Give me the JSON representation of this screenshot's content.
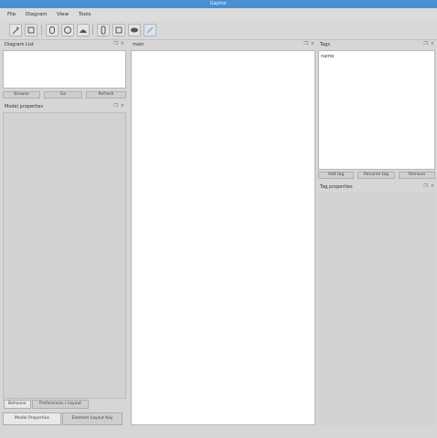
{
  "window": {
    "title": "Gaphor"
  },
  "menu": {
    "file": "File",
    "diagram": "Diagram",
    "view": "View",
    "tools": "Tools"
  },
  "toolbar": {
    "tools": [
      {
        "name": "pointer-tool-icon"
      },
      {
        "name": "comment-tool-icon"
      },
      {
        "name": "actor-tool-icon"
      },
      {
        "name": "use-case-tool-icon"
      },
      {
        "name": "package-tool-icon"
      },
      {
        "name": "class-tool-icon"
      },
      {
        "name": "component-tool-icon"
      },
      {
        "name": "node-tool-icon"
      },
      {
        "name": "line-tool-icon"
      }
    ]
  },
  "left_dock": {
    "top_title": "Diagram List",
    "buttons": [
      "Browse",
      "Go",
      "Refresh"
    ],
    "props_title": "Model properties",
    "tabs": [
      "Behavior",
      "Preferences / Layout"
    ],
    "bottom_tabs": [
      "Model Properties",
      "Element Layout Key"
    ]
  },
  "center": {
    "tab_label": "main"
  },
  "right_dock": {
    "title": "Tags",
    "list_item": "name",
    "buttons": [
      "Add tag",
      "Rename tag",
      "Remove"
    ],
    "props_title": "Tag properties"
  },
  "dock_controls": {
    "float": "❐",
    "close": "×"
  }
}
